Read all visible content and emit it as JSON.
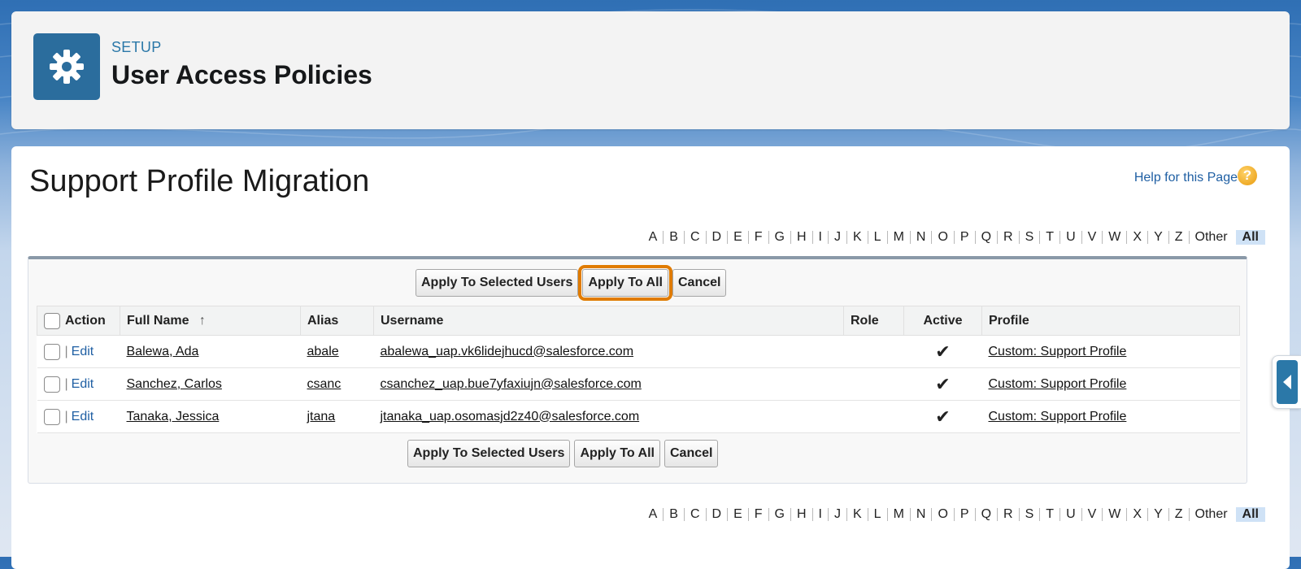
{
  "header": {
    "eyebrow": "SETUP",
    "title": "User Access Policies",
    "icon": "gear-icon"
  },
  "page": {
    "title": "Support Profile Migration",
    "help_link": "Help for this Page",
    "help_icon_glyph": "?"
  },
  "alphabet": [
    "A",
    "B",
    "C",
    "D",
    "E",
    "F",
    "G",
    "H",
    "I",
    "J",
    "K",
    "L",
    "M",
    "N",
    "O",
    "P",
    "Q",
    "R",
    "S",
    "T",
    "U",
    "V",
    "W",
    "X",
    "Y",
    "Z"
  ],
  "alphabet_other": "Other",
  "alphabet_all": "All",
  "buttons": {
    "apply_selected": "Apply To Selected Users",
    "apply_all": "Apply To All",
    "cancel": "Cancel"
  },
  "table": {
    "headers": {
      "action": "Action",
      "full_name": "Full Name",
      "sort_indicator": "↑",
      "alias": "Alias",
      "username": "Username",
      "role": "Role",
      "active": "Active",
      "profile": "Profile"
    },
    "edit_label": "Edit",
    "separator": "|",
    "rows": [
      {
        "full_name": "Balewa, Ada",
        "alias": "abale",
        "username": "abalewa_uap.vk6lidejhucd@salesforce.com",
        "role": "",
        "active": "✔",
        "profile": "Custom: Support Profile"
      },
      {
        "full_name": "Sanchez, Carlos",
        "alias": "csanc",
        "username": "csanchez_uap.bue7yfaxiujn@salesforce.com",
        "role": "",
        "active": "✔",
        "profile": "Custom: Support Profile"
      },
      {
        "full_name": "Tanaka, Jessica",
        "alias": "jtana",
        "username": "jtanaka_uap.osomasjd2z40@salesforce.com",
        "role": "",
        "active": "✔",
        "profile": "Custom: Support Profile"
      }
    ]
  },
  "colors": {
    "accent": "#2b78a8",
    "highlight": "#e07b00",
    "link": "#1f5fa3"
  }
}
